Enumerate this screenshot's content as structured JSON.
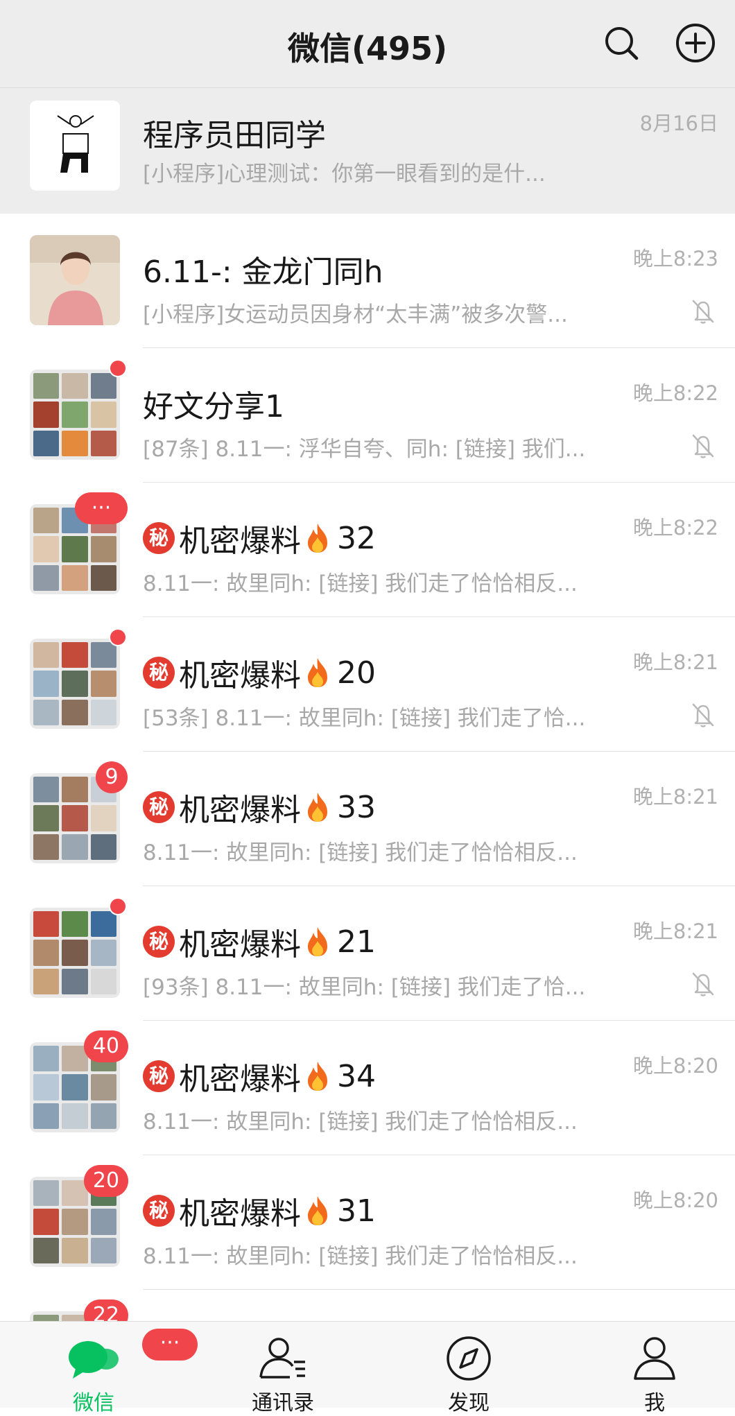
{
  "header": {
    "title": "微信(495)",
    "search_icon": "search-icon",
    "add_icon": "plus-circle-icon"
  },
  "chats": [
    {
      "title": "程序员田同学",
      "preview": "[小程序]心理测试：你第一眼看到的是什...",
      "time": "8月16日",
      "pinned": true,
      "muted": false,
      "badge": null,
      "secret": false,
      "fire": false
    },
    {
      "title": "6.11-: 金龙门同h",
      "preview": "[小程序]女运动员因身材“太丰满”被多次警...",
      "time": "晚上8:23",
      "pinned": false,
      "muted": true,
      "badge": null,
      "secret": false,
      "fire": false
    },
    {
      "title": "好文分享1",
      "preview": "[87条] 8.11一: 浮华自夸、同h: [链接] 我们...",
      "time": "晚上8:22",
      "pinned": false,
      "muted": true,
      "badge": "dot",
      "secret": false,
      "fire": false
    },
    {
      "title": "机密爆料",
      "suffix": "32",
      "preview": "8.11一: 故里同h: [链接] 我们走了恰恰相反...",
      "time": "晚上8:22",
      "pinned": false,
      "muted": false,
      "badge": "···",
      "secret": true,
      "fire": true
    },
    {
      "title": "机密爆料",
      "suffix": "20",
      "preview": "[53条] 8.11一: 故里同h: [链接] 我们走了恰...",
      "time": "晚上8:21",
      "pinned": false,
      "muted": true,
      "badge": "dot",
      "secret": true,
      "fire": true
    },
    {
      "title": "机密爆料",
      "suffix": "33",
      "preview": "8.11一: 故里同h: [链接] 我们走了恰恰相反...",
      "time": "晚上8:21",
      "pinned": false,
      "muted": false,
      "badge": "9",
      "secret": true,
      "fire": true
    },
    {
      "title": "机密爆料",
      "suffix": "21",
      "preview": "[93条] 8.11一: 故里同h: [链接] 我们走了恰...",
      "time": "晚上8:21",
      "pinned": false,
      "muted": true,
      "badge": "dot",
      "secret": true,
      "fire": true
    },
    {
      "title": "机密爆料",
      "suffix": "34",
      "preview": "8.11一: 故里同h: [链接] 我们走了恰恰相反...",
      "time": "晚上8:20",
      "pinned": false,
      "muted": false,
      "badge": "40",
      "secret": true,
      "fire": true
    },
    {
      "title": "机密爆料",
      "suffix": "31",
      "preview": "8.11一: 故里同h: [链接] 我们走了恰恰相反...",
      "time": "晚上8:20",
      "pinned": false,
      "muted": false,
      "badge": "20",
      "secret": true,
      "fire": true
    },
    {
      "title": "",
      "preview": "",
      "time": "",
      "pinned": false,
      "muted": false,
      "badge": "22",
      "secret": false,
      "fire": false
    }
  ],
  "secret_glyph": "秘",
  "tabs": [
    {
      "label": "微信",
      "icon": "chat-bubbles-icon",
      "active": true,
      "badge": "···"
    },
    {
      "label": "通讯录",
      "icon": "contacts-icon",
      "active": false
    },
    {
      "label": "发现",
      "icon": "compass-icon",
      "active": false
    },
    {
      "label": "我",
      "icon": "person-icon",
      "active": false
    }
  ],
  "colors": {
    "accent_green": "#07c160",
    "badge_red": "#f0454b",
    "header_bg": "#ededed",
    "pinned_bg": "#ededed",
    "secret_red": "#e33b2f"
  }
}
